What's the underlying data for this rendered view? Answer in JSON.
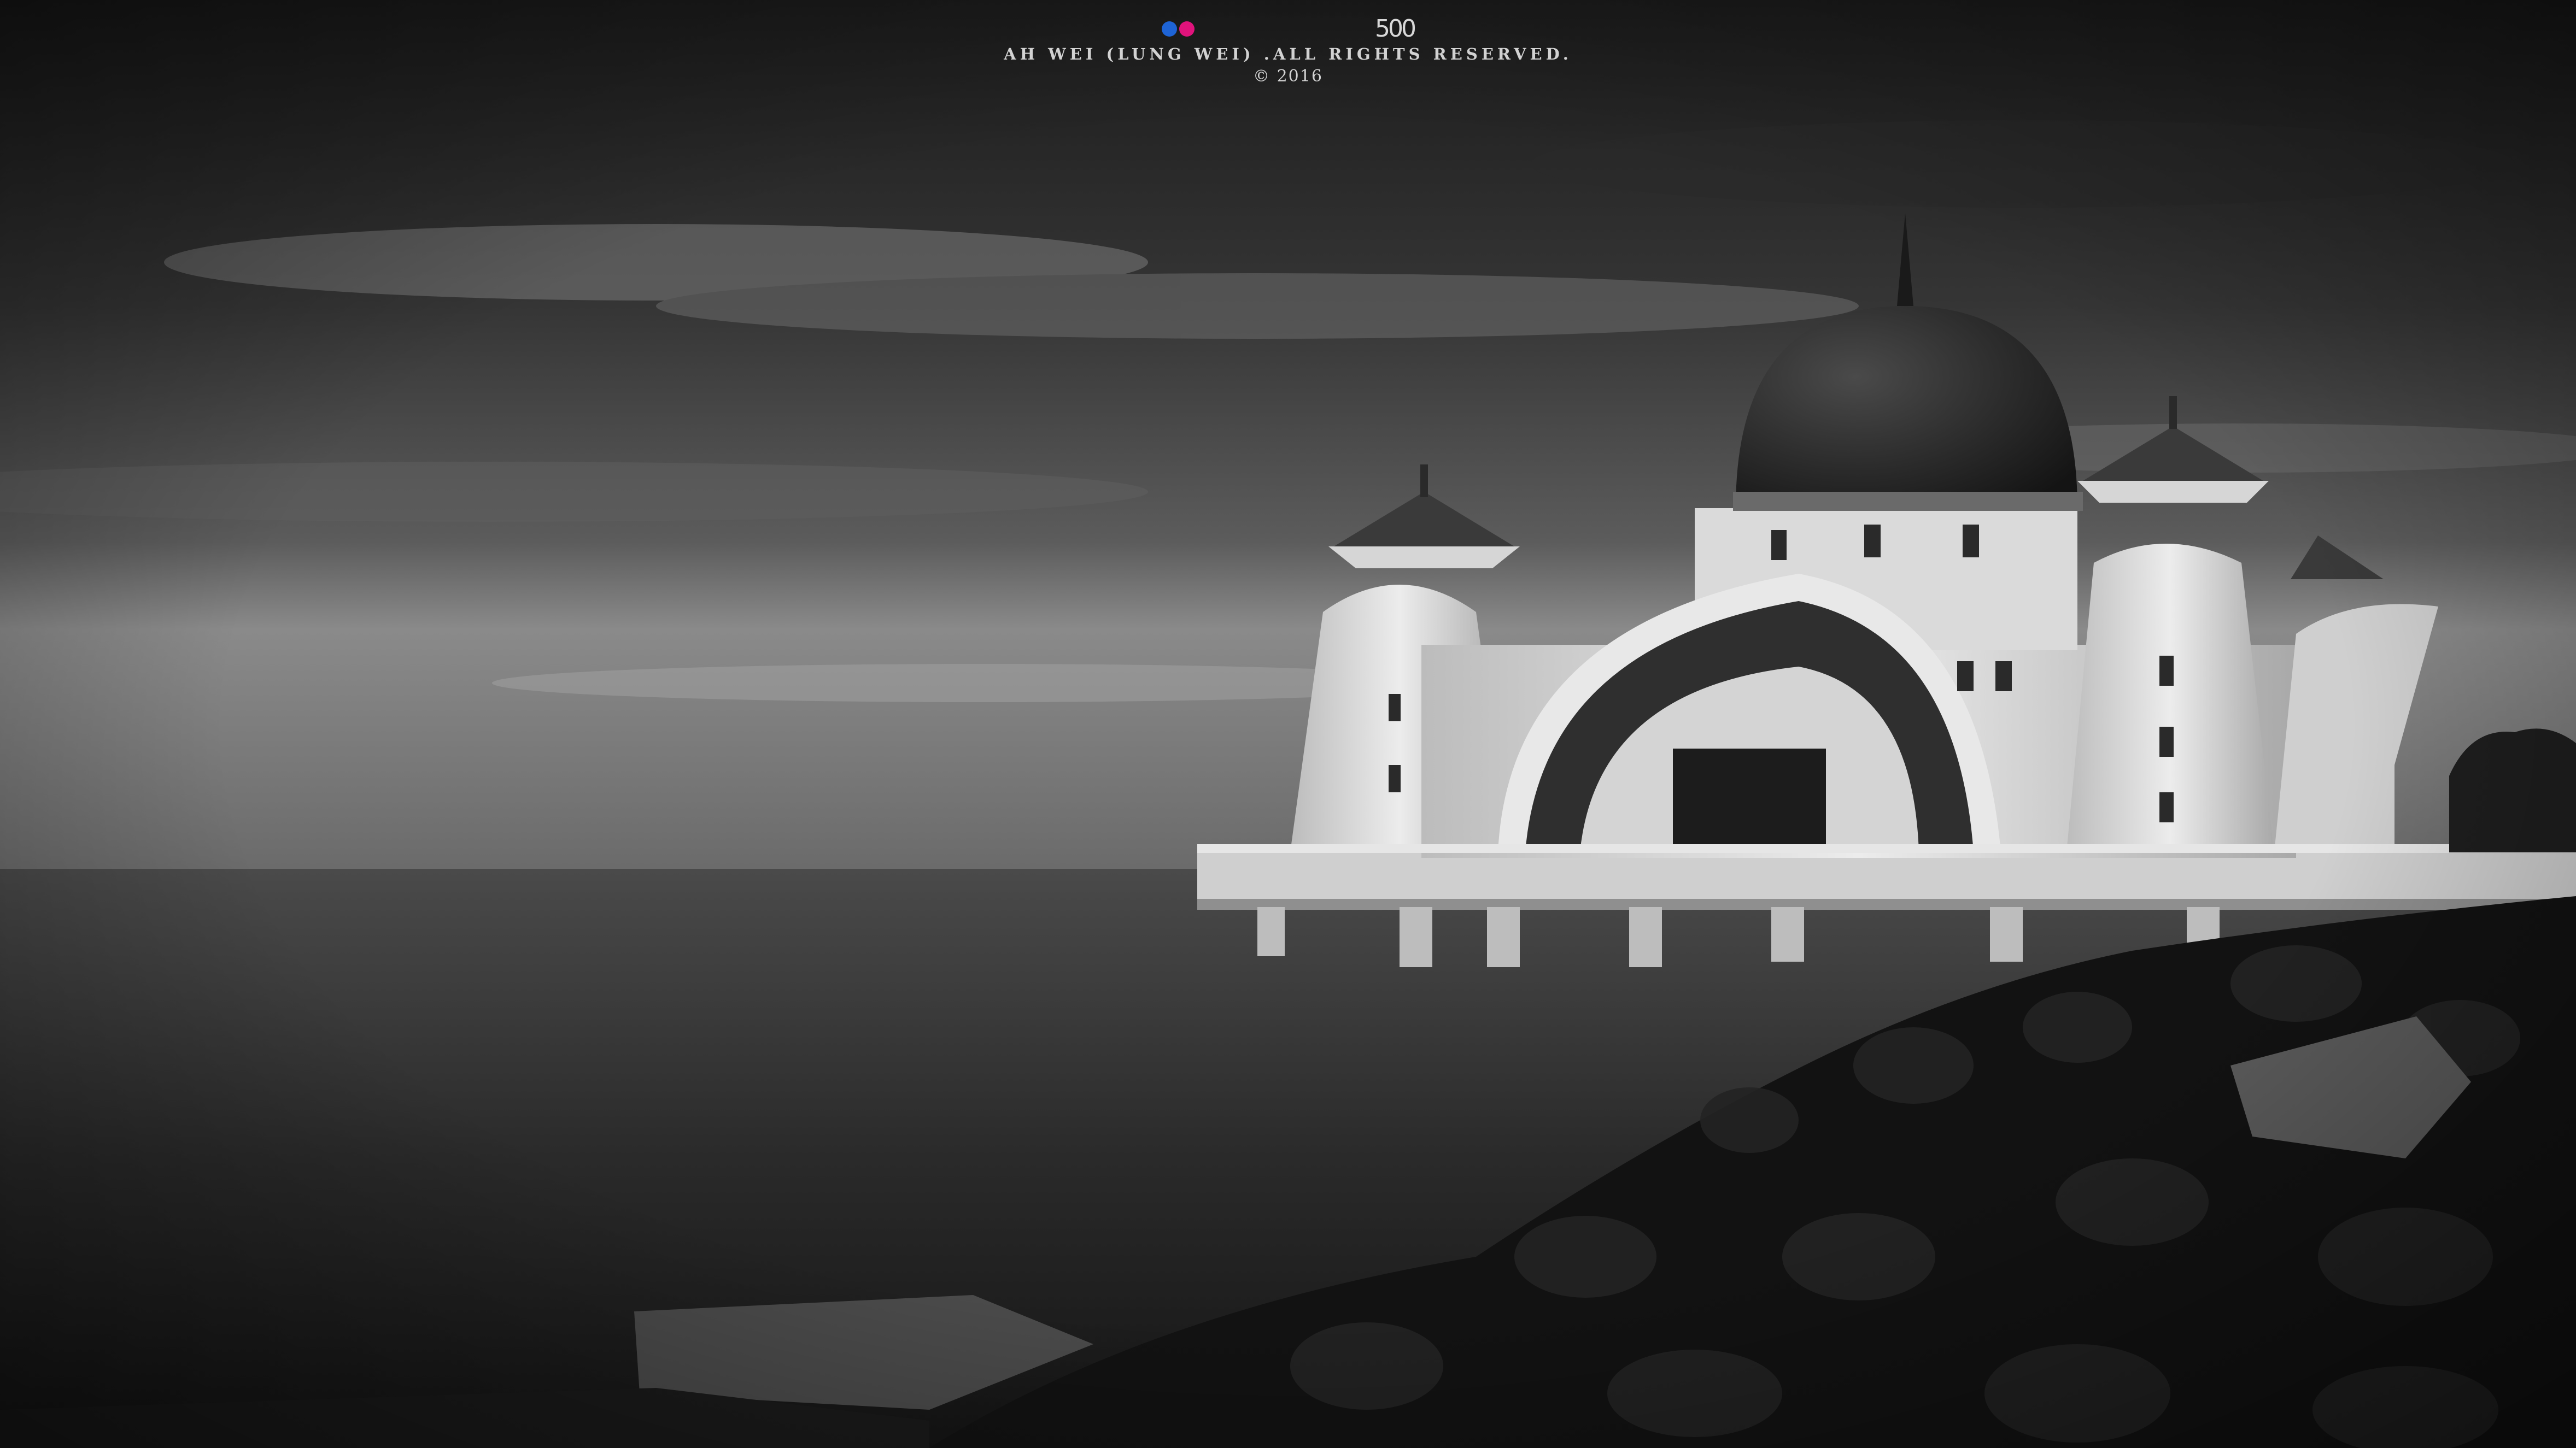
{
  "watermark": {
    "flickr_icon": "flickr-two-dots-icon",
    "px500_logo_text": "500",
    "credit": "AH WEI (LUNG WEI) .ALL RIGHTS RESERVED.",
    "copyright": "© 2016"
  },
  "colors": {
    "flickr_blue": "#1e64d6",
    "flickr_pink": "#e0137c"
  }
}
